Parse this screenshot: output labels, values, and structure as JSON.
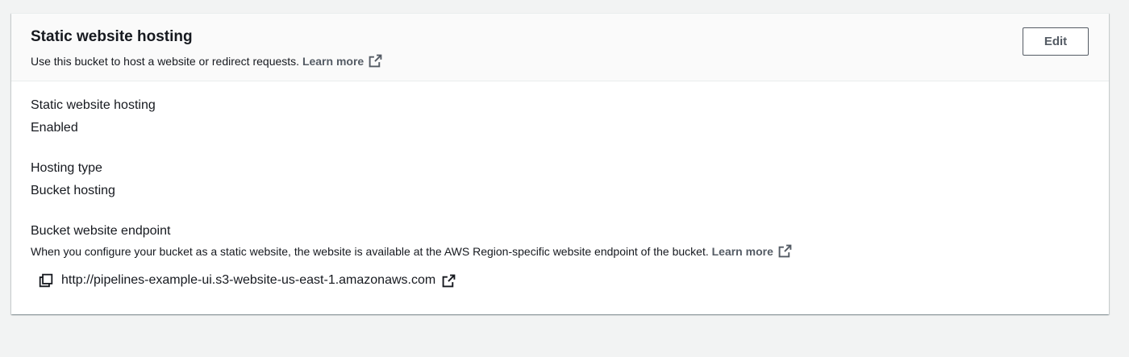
{
  "header": {
    "title": "Static website hosting",
    "description": "Use this bucket to host a website or redirect requests.",
    "learn_more": "Learn more",
    "edit_label": "Edit"
  },
  "fields": {
    "static_hosting": {
      "label": "Static website hosting",
      "value": "Enabled"
    },
    "hosting_type": {
      "label": "Hosting type",
      "value": "Bucket hosting"
    },
    "endpoint": {
      "label": "Bucket website endpoint",
      "description": "When you configure your bucket as a static website, the website is available at the AWS Region-specific website endpoint of the bucket.",
      "learn_more": "Learn more",
      "url": "http://pipelines-example-ui.s3-website-us-east-1.amazonaws.com"
    }
  },
  "icons": {
    "external_link": "external-link-icon",
    "copy": "copy-icon"
  },
  "colors": {
    "background": "#f2f3f3",
    "panel": "#ffffff",
    "header_bg": "#fafafa",
    "text": "#16191f",
    "secondary": "#545b64"
  }
}
